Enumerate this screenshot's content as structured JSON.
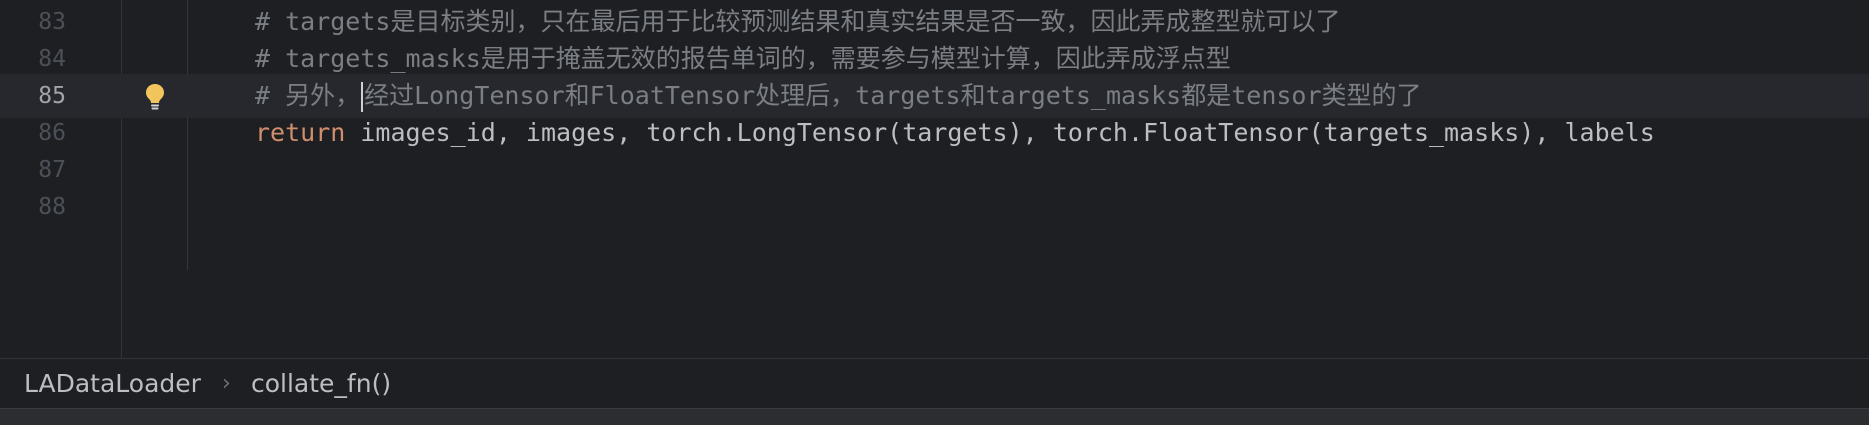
{
  "editor": {
    "current_line": "85",
    "lines": [
      {
        "number": "83",
        "text": "# targets是目标类别，只在最后用于比较预测结果和真实结果是否一致，因此弄成整型就可以了"
      },
      {
        "number": "84",
        "text": "# targets_masks是用于掩盖无效的报告单词的，需要参与模型计算，因此弄成浮点型"
      },
      {
        "number": "85",
        "text_before_caret": "# 另外，",
        "text_after_caret": "经过LongTensor和FloatTensor处理后，targets和targets_masks都是tensor类型的了"
      },
      {
        "number": "86",
        "keyword": "return",
        "text": " images_id, images, torch.LongTensor(targets), torch.FloatTensor(targets_masks), labels"
      },
      {
        "number": "87",
        "text": ""
      },
      {
        "number": "88",
        "text": ""
      }
    ],
    "intention_icon": "lightbulb-icon"
  },
  "breadcrumbs": {
    "items": [
      "LADataLoader",
      "collate_fn()"
    ],
    "separator": "›"
  },
  "colors": {
    "background": "#1e1f22",
    "current_line": "#26282e",
    "comment": "#7a7e85",
    "keyword": "#cf8e6d",
    "text": "#bcbec4",
    "line_number": "#4b5059",
    "bulb": "#f2c55c"
  }
}
